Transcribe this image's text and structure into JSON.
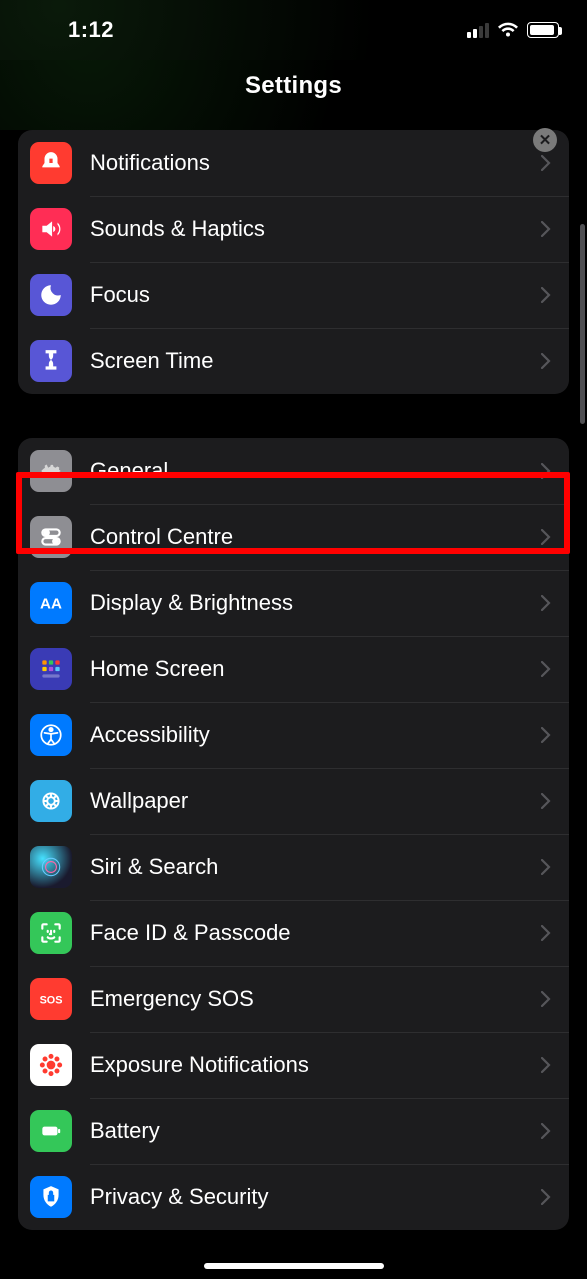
{
  "statusbar": {
    "time": "1:12"
  },
  "header": {
    "title": "Settings"
  },
  "group1": {
    "items": [
      {
        "label": "Notifications"
      },
      {
        "label": "Sounds & Haptics"
      },
      {
        "label": "Focus"
      },
      {
        "label": "Screen Time"
      }
    ]
  },
  "group2": {
    "items": [
      {
        "label": "General"
      },
      {
        "label": "Control Centre"
      },
      {
        "label": "Display & Brightness"
      },
      {
        "label": "Home Screen"
      },
      {
        "label": "Accessibility"
      },
      {
        "label": "Wallpaper"
      },
      {
        "label": "Siri & Search"
      },
      {
        "label": "Face ID & Passcode"
      },
      {
        "label": "Emergency SOS"
      },
      {
        "label": "Exposure Notifications"
      },
      {
        "label": "Battery"
      },
      {
        "label": "Privacy & Security"
      }
    ]
  },
  "annotation": {
    "highlighted_row": "General"
  }
}
